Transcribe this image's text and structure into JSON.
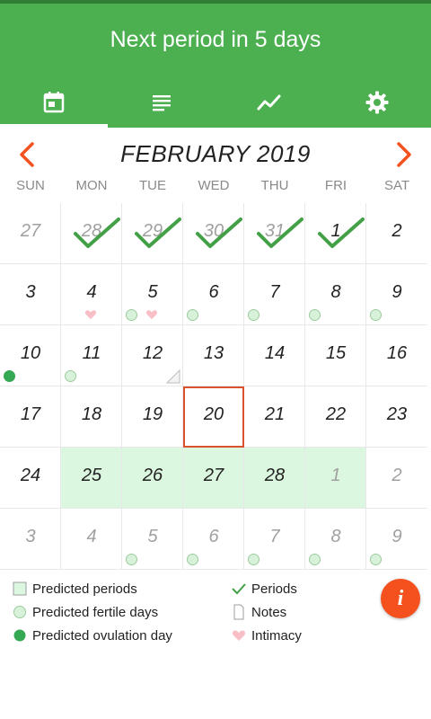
{
  "header": {
    "title": "Next period in 5 days"
  },
  "tabs": [
    {
      "icon": "calendar-icon",
      "active": true
    },
    {
      "icon": "list-icon",
      "active": false
    },
    {
      "icon": "chart-icon",
      "active": false
    },
    {
      "icon": "gear-icon",
      "active": false
    }
  ],
  "calendar": {
    "month_title": "FEBRUARY 2019",
    "weekdays": [
      "SUN",
      "MON",
      "TUE",
      "WED",
      "THU",
      "FRI",
      "SAT"
    ],
    "weeks": [
      [
        {
          "day": "27",
          "in_month": false,
          "period": false,
          "fertile": false,
          "ovulation": false,
          "intimacy": false,
          "note": false,
          "predicted": false
        },
        {
          "day": "28",
          "in_month": false,
          "period": true,
          "fertile": false,
          "ovulation": false,
          "intimacy": false,
          "note": false,
          "predicted": false
        },
        {
          "day": "29",
          "in_month": false,
          "period": true,
          "fertile": false,
          "ovulation": false,
          "intimacy": false,
          "note": false,
          "predicted": false
        },
        {
          "day": "30",
          "in_month": false,
          "period": true,
          "fertile": false,
          "ovulation": false,
          "intimacy": false,
          "note": false,
          "predicted": false
        },
        {
          "day": "31",
          "in_month": false,
          "period": true,
          "fertile": false,
          "ovulation": false,
          "intimacy": false,
          "note": false,
          "predicted": false
        },
        {
          "day": "1",
          "in_month": true,
          "period": true,
          "fertile": false,
          "ovulation": false,
          "intimacy": false,
          "note": false,
          "predicted": false
        },
        {
          "day": "2",
          "in_month": true,
          "period": false,
          "fertile": false,
          "ovulation": false,
          "intimacy": false,
          "note": false,
          "predicted": false
        }
      ],
      [
        {
          "day": "3",
          "in_month": true,
          "period": false,
          "fertile": false,
          "ovulation": false,
          "intimacy": false,
          "note": false,
          "predicted": false
        },
        {
          "day": "4",
          "in_month": true,
          "period": false,
          "fertile": false,
          "ovulation": false,
          "intimacy": true,
          "note": false,
          "predicted": false
        },
        {
          "day": "5",
          "in_month": true,
          "period": false,
          "fertile": true,
          "ovulation": false,
          "intimacy": true,
          "note": false,
          "predicted": false
        },
        {
          "day": "6",
          "in_month": true,
          "period": false,
          "fertile": true,
          "ovulation": false,
          "intimacy": false,
          "note": false,
          "predicted": false
        },
        {
          "day": "7",
          "in_month": true,
          "period": false,
          "fertile": true,
          "ovulation": false,
          "intimacy": false,
          "note": false,
          "predicted": false
        },
        {
          "day": "8",
          "in_month": true,
          "period": false,
          "fertile": true,
          "ovulation": false,
          "intimacy": false,
          "note": false,
          "predicted": false
        },
        {
          "day": "9",
          "in_month": true,
          "period": false,
          "fertile": true,
          "ovulation": false,
          "intimacy": false,
          "note": false,
          "predicted": false
        }
      ],
      [
        {
          "day": "10",
          "in_month": true,
          "period": false,
          "fertile": false,
          "ovulation": true,
          "intimacy": false,
          "note": false,
          "predicted": false
        },
        {
          "day": "11",
          "in_month": true,
          "period": false,
          "fertile": true,
          "ovulation": false,
          "intimacy": false,
          "note": false,
          "predicted": false
        },
        {
          "day": "12",
          "in_month": true,
          "period": false,
          "fertile": false,
          "ovulation": false,
          "intimacy": false,
          "note": true,
          "predicted": false
        },
        {
          "day": "13",
          "in_month": true,
          "period": false,
          "fertile": false,
          "ovulation": false,
          "intimacy": false,
          "note": false,
          "predicted": false
        },
        {
          "day": "14",
          "in_month": true,
          "period": false,
          "fertile": false,
          "ovulation": false,
          "intimacy": false,
          "note": false,
          "predicted": false
        },
        {
          "day": "15",
          "in_month": true,
          "period": false,
          "fertile": false,
          "ovulation": false,
          "intimacy": false,
          "note": false,
          "predicted": false
        },
        {
          "day": "16",
          "in_month": true,
          "period": false,
          "fertile": false,
          "ovulation": false,
          "intimacy": false,
          "note": false,
          "predicted": false
        }
      ],
      [
        {
          "day": "17",
          "in_month": true,
          "period": false,
          "fertile": false,
          "ovulation": false,
          "intimacy": false,
          "note": false,
          "predicted": false
        },
        {
          "day": "18",
          "in_month": true,
          "period": false,
          "fertile": false,
          "ovulation": false,
          "intimacy": false,
          "note": false,
          "predicted": false
        },
        {
          "day": "19",
          "in_month": true,
          "period": false,
          "fertile": false,
          "ovulation": false,
          "intimacy": false,
          "note": false,
          "predicted": false
        },
        {
          "day": "20",
          "in_month": true,
          "period": false,
          "fertile": false,
          "ovulation": false,
          "intimacy": false,
          "note": false,
          "predicted": false,
          "today": true
        },
        {
          "day": "21",
          "in_month": true,
          "period": false,
          "fertile": false,
          "ovulation": false,
          "intimacy": false,
          "note": false,
          "predicted": false
        },
        {
          "day": "22",
          "in_month": true,
          "period": false,
          "fertile": false,
          "ovulation": false,
          "intimacy": false,
          "note": false,
          "predicted": false
        },
        {
          "day": "23",
          "in_month": true,
          "period": false,
          "fertile": false,
          "ovulation": false,
          "intimacy": false,
          "note": false,
          "predicted": false
        }
      ],
      [
        {
          "day": "24",
          "in_month": true,
          "period": false,
          "fertile": false,
          "ovulation": false,
          "intimacy": false,
          "note": false,
          "predicted": false
        },
        {
          "day": "25",
          "in_month": true,
          "period": false,
          "fertile": false,
          "ovulation": false,
          "intimacy": false,
          "note": false,
          "predicted": true
        },
        {
          "day": "26",
          "in_month": true,
          "period": false,
          "fertile": false,
          "ovulation": false,
          "intimacy": false,
          "note": false,
          "predicted": true
        },
        {
          "day": "27",
          "in_month": true,
          "period": false,
          "fertile": false,
          "ovulation": false,
          "intimacy": false,
          "note": false,
          "predicted": true
        },
        {
          "day": "28",
          "in_month": true,
          "period": false,
          "fertile": false,
          "ovulation": false,
          "intimacy": false,
          "note": false,
          "predicted": true
        },
        {
          "day": "1",
          "in_month": false,
          "period": false,
          "fertile": false,
          "ovulation": false,
          "intimacy": false,
          "note": false,
          "predicted": true
        },
        {
          "day": "2",
          "in_month": false,
          "period": false,
          "fertile": false,
          "ovulation": false,
          "intimacy": false,
          "note": false,
          "predicted": false
        }
      ],
      [
        {
          "day": "3",
          "in_month": false,
          "period": false,
          "fertile": false,
          "ovulation": false,
          "intimacy": false,
          "note": false,
          "predicted": false
        },
        {
          "day": "4",
          "in_month": false,
          "period": false,
          "fertile": false,
          "ovulation": false,
          "intimacy": false,
          "note": false,
          "predicted": false
        },
        {
          "day": "5",
          "in_month": false,
          "period": false,
          "fertile": true,
          "ovulation": false,
          "intimacy": false,
          "note": false,
          "predicted": false
        },
        {
          "day": "6",
          "in_month": false,
          "period": false,
          "fertile": true,
          "ovulation": false,
          "intimacy": false,
          "note": false,
          "predicted": false
        },
        {
          "day": "7",
          "in_month": false,
          "period": false,
          "fertile": true,
          "ovulation": false,
          "intimacy": false,
          "note": false,
          "predicted": false
        },
        {
          "day": "8",
          "in_month": false,
          "period": false,
          "fertile": true,
          "ovulation": false,
          "intimacy": false,
          "note": false,
          "predicted": false
        },
        {
          "day": "9",
          "in_month": false,
          "period": false,
          "fertile": true,
          "ovulation": false,
          "intimacy": false,
          "note": false,
          "predicted": false
        }
      ]
    ]
  },
  "legend": {
    "predicted_periods": "Predicted periods",
    "predicted_fertile": "Predicted fertile days",
    "predicted_ovulation": "Predicted ovulation day",
    "periods": "Periods",
    "notes": "Notes",
    "intimacy": "Intimacy"
  },
  "info_button": {
    "label": "i"
  },
  "colors": {
    "header": "#4caf50",
    "status_bar": "#2e7d32",
    "accent": "#f4511e",
    "check": "#43a047",
    "predicted_fill": "#dcf7e0",
    "fertile_fill": "#d7f2d9",
    "ovulation": "#34a853",
    "intimacy": "#f8bfc7",
    "today_border": "#d9532f"
  }
}
